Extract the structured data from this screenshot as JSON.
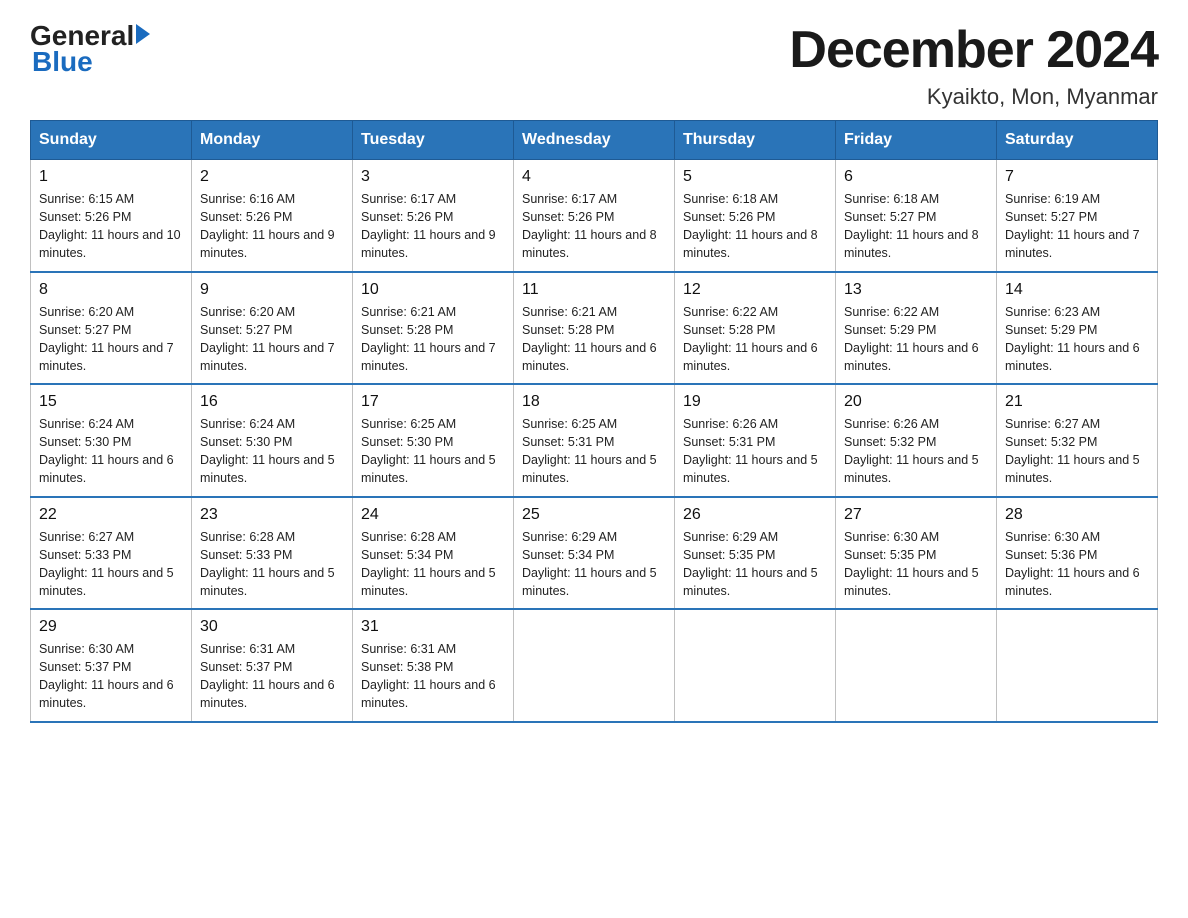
{
  "logo": {
    "general": "General",
    "blue": "Blue"
  },
  "title": "December 2024",
  "subtitle": "Kyaikto, Mon, Myanmar",
  "weekdays": [
    "Sunday",
    "Monday",
    "Tuesday",
    "Wednesday",
    "Thursday",
    "Friday",
    "Saturday"
  ],
  "weeks": [
    [
      {
        "day": "1",
        "sunrise": "6:15 AM",
        "sunset": "5:26 PM",
        "daylight": "11 hours and 10 minutes."
      },
      {
        "day": "2",
        "sunrise": "6:16 AM",
        "sunset": "5:26 PM",
        "daylight": "11 hours and 9 minutes."
      },
      {
        "day": "3",
        "sunrise": "6:17 AM",
        "sunset": "5:26 PM",
        "daylight": "11 hours and 9 minutes."
      },
      {
        "day": "4",
        "sunrise": "6:17 AM",
        "sunset": "5:26 PM",
        "daylight": "11 hours and 8 minutes."
      },
      {
        "day": "5",
        "sunrise": "6:18 AM",
        "sunset": "5:26 PM",
        "daylight": "11 hours and 8 minutes."
      },
      {
        "day": "6",
        "sunrise": "6:18 AM",
        "sunset": "5:27 PM",
        "daylight": "11 hours and 8 minutes."
      },
      {
        "day": "7",
        "sunrise": "6:19 AM",
        "sunset": "5:27 PM",
        "daylight": "11 hours and 7 minutes."
      }
    ],
    [
      {
        "day": "8",
        "sunrise": "6:20 AM",
        "sunset": "5:27 PM",
        "daylight": "11 hours and 7 minutes."
      },
      {
        "day": "9",
        "sunrise": "6:20 AM",
        "sunset": "5:27 PM",
        "daylight": "11 hours and 7 minutes."
      },
      {
        "day": "10",
        "sunrise": "6:21 AM",
        "sunset": "5:28 PM",
        "daylight": "11 hours and 7 minutes."
      },
      {
        "day": "11",
        "sunrise": "6:21 AM",
        "sunset": "5:28 PM",
        "daylight": "11 hours and 6 minutes."
      },
      {
        "day": "12",
        "sunrise": "6:22 AM",
        "sunset": "5:28 PM",
        "daylight": "11 hours and 6 minutes."
      },
      {
        "day": "13",
        "sunrise": "6:22 AM",
        "sunset": "5:29 PM",
        "daylight": "11 hours and 6 minutes."
      },
      {
        "day": "14",
        "sunrise": "6:23 AM",
        "sunset": "5:29 PM",
        "daylight": "11 hours and 6 minutes."
      }
    ],
    [
      {
        "day": "15",
        "sunrise": "6:24 AM",
        "sunset": "5:30 PM",
        "daylight": "11 hours and 6 minutes."
      },
      {
        "day": "16",
        "sunrise": "6:24 AM",
        "sunset": "5:30 PM",
        "daylight": "11 hours and 5 minutes."
      },
      {
        "day": "17",
        "sunrise": "6:25 AM",
        "sunset": "5:30 PM",
        "daylight": "11 hours and 5 minutes."
      },
      {
        "day": "18",
        "sunrise": "6:25 AM",
        "sunset": "5:31 PM",
        "daylight": "11 hours and 5 minutes."
      },
      {
        "day": "19",
        "sunrise": "6:26 AM",
        "sunset": "5:31 PM",
        "daylight": "11 hours and 5 minutes."
      },
      {
        "day": "20",
        "sunrise": "6:26 AM",
        "sunset": "5:32 PM",
        "daylight": "11 hours and 5 minutes."
      },
      {
        "day": "21",
        "sunrise": "6:27 AM",
        "sunset": "5:32 PM",
        "daylight": "11 hours and 5 minutes."
      }
    ],
    [
      {
        "day": "22",
        "sunrise": "6:27 AM",
        "sunset": "5:33 PM",
        "daylight": "11 hours and 5 minutes."
      },
      {
        "day": "23",
        "sunrise": "6:28 AM",
        "sunset": "5:33 PM",
        "daylight": "11 hours and 5 minutes."
      },
      {
        "day": "24",
        "sunrise": "6:28 AM",
        "sunset": "5:34 PM",
        "daylight": "11 hours and 5 minutes."
      },
      {
        "day": "25",
        "sunrise": "6:29 AM",
        "sunset": "5:34 PM",
        "daylight": "11 hours and 5 minutes."
      },
      {
        "day": "26",
        "sunrise": "6:29 AM",
        "sunset": "5:35 PM",
        "daylight": "11 hours and 5 minutes."
      },
      {
        "day": "27",
        "sunrise": "6:30 AM",
        "sunset": "5:35 PM",
        "daylight": "11 hours and 5 minutes."
      },
      {
        "day": "28",
        "sunrise": "6:30 AM",
        "sunset": "5:36 PM",
        "daylight": "11 hours and 6 minutes."
      }
    ],
    [
      {
        "day": "29",
        "sunrise": "6:30 AM",
        "sunset": "5:37 PM",
        "daylight": "11 hours and 6 minutes."
      },
      {
        "day": "30",
        "sunrise": "6:31 AM",
        "sunset": "5:37 PM",
        "daylight": "11 hours and 6 minutes."
      },
      {
        "day": "31",
        "sunrise": "6:31 AM",
        "sunset": "5:38 PM",
        "daylight": "11 hours and 6 minutes."
      },
      null,
      null,
      null,
      null
    ]
  ]
}
